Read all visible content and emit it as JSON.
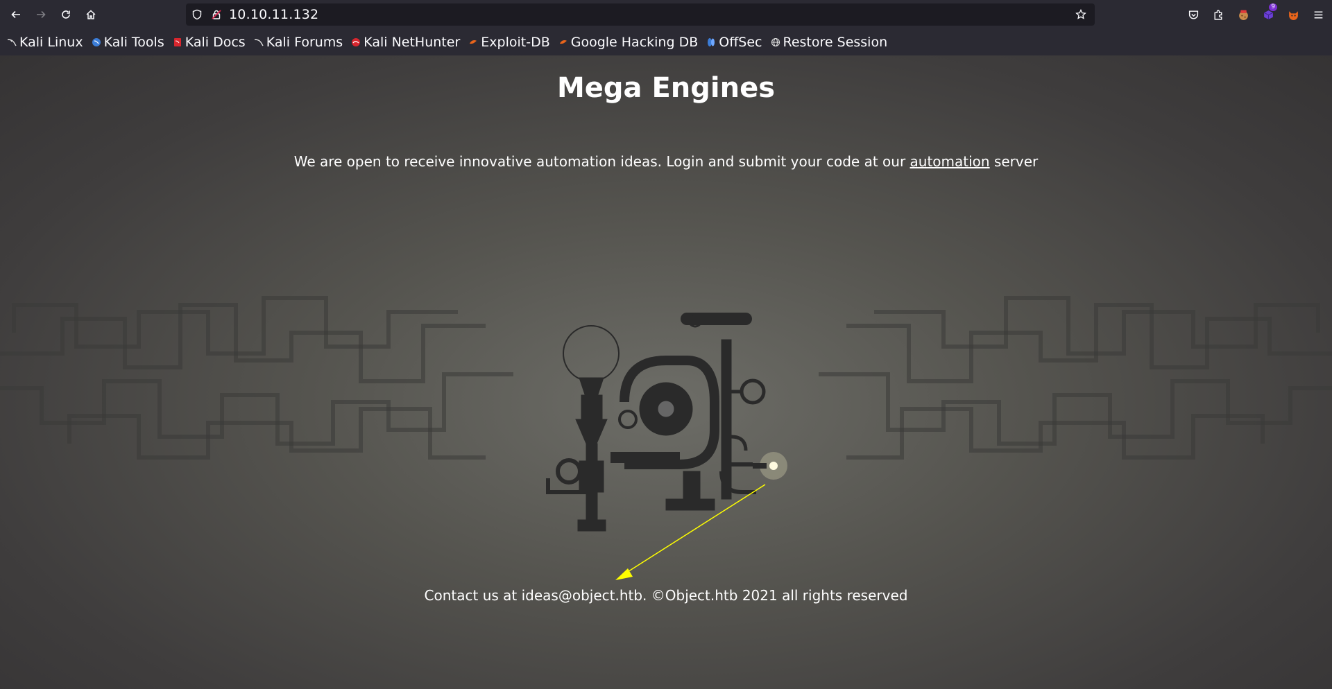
{
  "browser": {
    "url": "10.10.11.132",
    "bookmarks": [
      {
        "label": "Kali Linux",
        "icon": "kali-dragon-icon",
        "color": "#e0e0e0"
      },
      {
        "label": "Kali Tools",
        "icon": "kali-tools-icon",
        "color": "#3b7dd8"
      },
      {
        "label": "Kali Docs",
        "icon": "kali-docs-icon",
        "color": "#d8262e"
      },
      {
        "label": "Kali Forums",
        "icon": "kali-forums-icon",
        "color": "#e0e0e0"
      },
      {
        "label": "Kali NetHunter",
        "icon": "nethunter-icon",
        "color": "#d8262e"
      },
      {
        "label": "Exploit-DB",
        "icon": "exploit-db-icon",
        "color": "#e8641b"
      },
      {
        "label": "Google Hacking DB",
        "icon": "ghdb-icon",
        "color": "#e8641b"
      },
      {
        "label": "OffSec",
        "icon": "offsec-icon",
        "color": "#3b7dd8"
      },
      {
        "label": "Restore Session",
        "icon": "globe-icon",
        "color": "#e0e0e0"
      }
    ],
    "extension_badge": "9"
  },
  "page": {
    "title": "Mega Engines",
    "lead_before": "We are open to receive innovative automation ideas. Login and submit your code at our ",
    "lead_link": "automation",
    "lead_after": " server",
    "footer": "Contact us at ideas@object.htb. ©Object.htb 2021 all rights reserved"
  },
  "colors": {
    "chrome": "#2b2a33",
    "urlbar": "#1c1b22",
    "annotation_arrow": "#ffff00"
  }
}
